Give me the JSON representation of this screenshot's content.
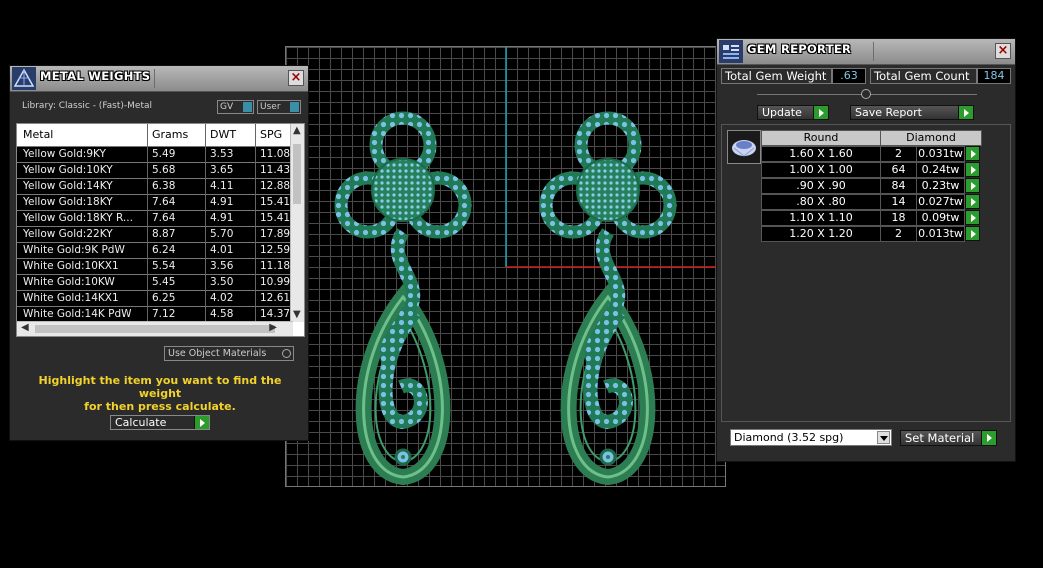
{
  "metal_weights": {
    "title": "METAL WEIGHTS",
    "library": "Library: Classic - (Fast)-Metal",
    "toggle_gv": "GV",
    "toggle_user": "User",
    "columns": [
      "Metal",
      "Grams",
      "DWT",
      "SPG"
    ],
    "rows": [
      [
        "Yellow Gold:9KY",
        "5.49",
        "3.53",
        "11.08"
      ],
      [
        "Yellow Gold:10KY",
        "5.68",
        "3.65",
        "11.43"
      ],
      [
        "Yellow Gold:14KY",
        "6.38",
        "4.11",
        "12.88"
      ],
      [
        "Yellow Gold:18KY",
        "7.64",
        "4.91",
        "15.41"
      ],
      [
        "Yellow Gold:18KY R...",
        "7.64",
        "4.91",
        "15.41"
      ],
      [
        "Yellow Gold:22KY",
        "8.87",
        "5.70",
        "17.89"
      ],
      [
        "White Gold:9K PdW",
        "6.24",
        "4.01",
        "12.59"
      ],
      [
        "White Gold:10KX1",
        "5.54",
        "3.56",
        "11.18"
      ],
      [
        "White Gold:10KW",
        "5.45",
        "3.50",
        "10.99"
      ],
      [
        "White Gold:14KX1",
        "6.25",
        "4.02",
        "12.61"
      ],
      [
        "White Gold:14K PdW",
        "7.12",
        "4.58",
        "14.37"
      ]
    ],
    "use_object_materials": "Use Object Materials",
    "hint_line1": "Highlight the item you want to find the weight",
    "hint_line2": "for then press calculate.",
    "calculate_label": "Calculate"
  },
  "gem_reporter": {
    "title": "GEM REPORTER",
    "total_weight_label": "Total Gem Weight",
    "total_weight_value": ".63",
    "total_count_label": "Total Gem Count",
    "total_count_value": "184",
    "update_label": "Update",
    "save_report_label": "Save Report",
    "shape_header": "Round",
    "material_header": "Diamond",
    "gems": [
      [
        "1.60 X 1.60",
        "2",
        "0.031tw"
      ],
      [
        "1.00 X 1.00",
        "64",
        "0.24tw"
      ],
      [
        ".90 X .90",
        "84",
        "0.23tw"
      ],
      [
        ".80 X .80",
        "14",
        "0.027tw"
      ],
      [
        "1.10 X 1.10",
        "18",
        "0.09tw"
      ],
      [
        "1.20 X 1.20",
        "2",
        "0.013tw"
      ]
    ],
    "material_select": "Diamond    (3.52 spg)",
    "set_material_label": "Set Material"
  },
  "colors": {
    "metal_green": "#2f8a5a",
    "gem_blue": "#6fb7e0",
    "axis_red": "#cc2222",
    "axis_cyan": "#1aa3b8",
    "hint_yellow": "#f2d22c"
  },
  "icons": [
    "panel-logo-icon",
    "close-icon",
    "arrow-right-icon",
    "gem-shape-icon",
    "dropdown-arrow-icon"
  ]
}
